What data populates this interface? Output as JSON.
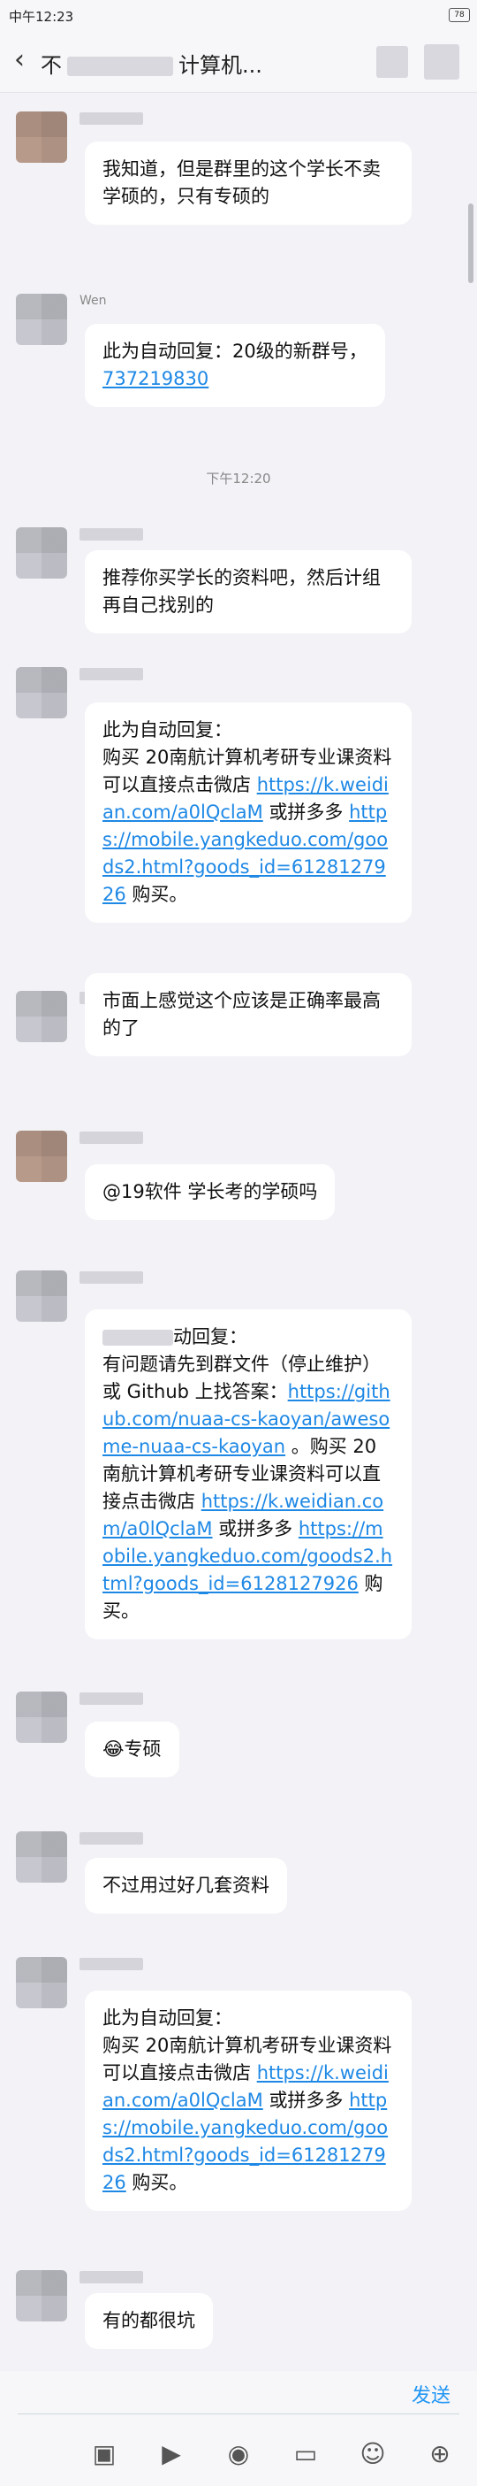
{
  "status_bar": {
    "time": "中午12:23",
    "battery": "78"
  },
  "header": {
    "title_prefix": "不",
    "title_suffix": "计算机..."
  },
  "messages": [
    {
      "text": "我知道，但是群里的这个学长不卖学硕的，只有专硕的"
    },
    {
      "sender": "Wen",
      "text": "此为自动回复：20级的新群号，",
      "link": "737219830"
    },
    {
      "text": "推荐你买学长的资料吧，然后计组再自己找别的"
    },
    {
      "text_parts": [
        "此为自动回复：",
        "购买 20南航计算机考研专业课资料可以直接点击微店 ",
        "https://k.weidian.com/a0lQclaM",
        " 或拼多多 ",
        "https://mobile.yangkeduo.com/goods2.html?goods_id=6128127926",
        " 购买。"
      ]
    },
    {
      "text": "市面上感觉这个应该是正确率最高的了"
    },
    {
      "text": "@19软件 学长考的学硕吗"
    },
    {
      "text_parts": [
        "动回复：",
        "有问题请先到群文件（停止维护）或 Github 上找答案：",
        "https://github.com/nuaa-cs-kaoyan/awesome-nuaa-cs-kaoyan",
        " 。购买 20南航计算机考研专业课资料可以直接点击微店 ",
        "https://k.weidian.com/a0lQclaM",
        " 或拼多多 ",
        "https://mobile.yangkeduo.com/goods2.html?goods_id=6128127926",
        " 购买。"
      ]
    },
    {
      "emoji": "😂",
      "text": "专硕"
    },
    {
      "text": "不过用过好几套资料"
    },
    {
      "text_parts": [
        "此为自动回复：",
        "购买 20南航计算机考研专业课资料可以直接点击微店 ",
        "https://k.weidian.com/a0lQclaM",
        " 或拼多多 ",
        "https://mobile.yangkeduo.com/goods2.html?goods_id=6128127926",
        " 购买。"
      ]
    },
    {
      "text": "有的都很坑"
    }
  ],
  "timestamp": "下午12:20",
  "composer": {
    "send_label": "发送"
  },
  "toolbar_icons": [
    "image-icon",
    "video-icon",
    "camera-icon",
    "folder-icon",
    "emoji-icon",
    "plus-icon"
  ]
}
